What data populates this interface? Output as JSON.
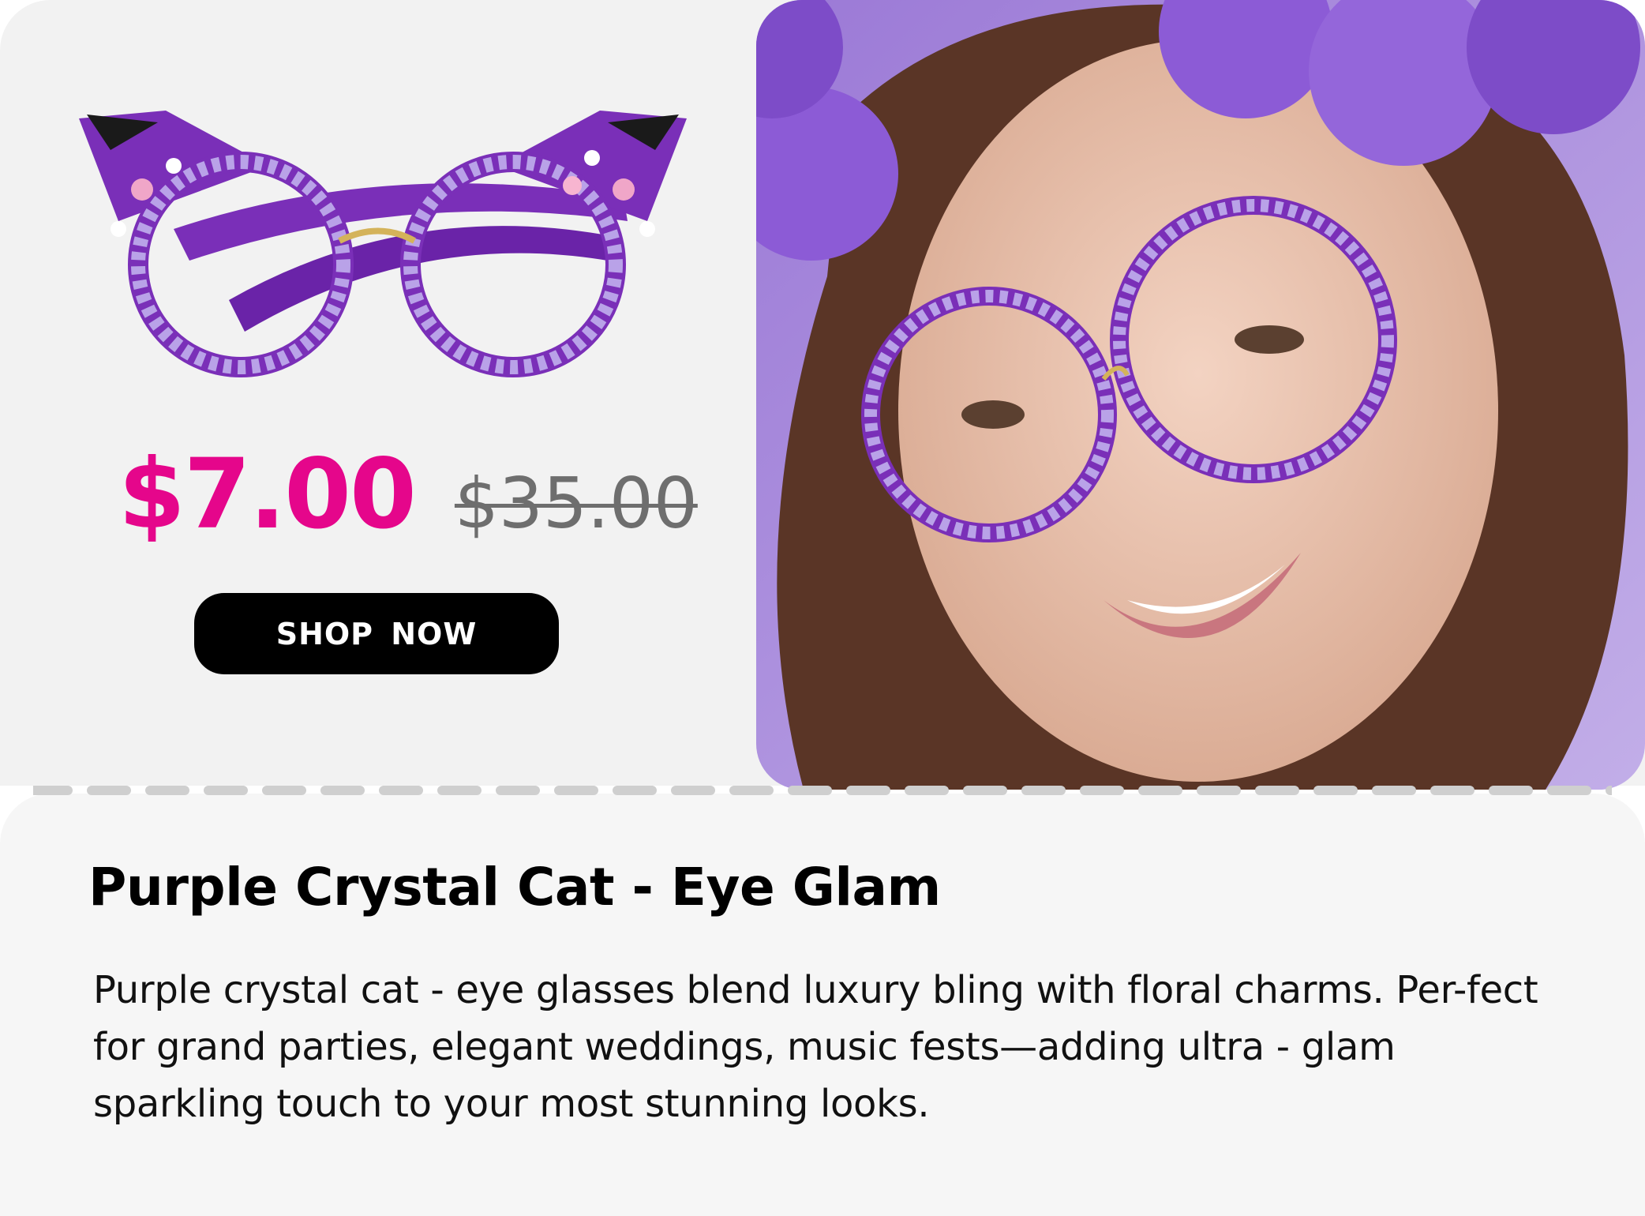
{
  "price": {
    "sale": "$7.00",
    "original": "$35.00",
    "sale_color": "#e5068b",
    "original_color": "#6e6e6e"
  },
  "cta": {
    "label": "SHOP  NOW"
  },
  "product": {
    "title": "Purple Crystal Cat - Eye Glam",
    "description": "Purple crystal cat - eye glasses blend luxury bling with floral charms. Per-fect for grand parties, elegant weddings, music fests—adding ultra - glam sparkling touch to your most stunning looks."
  },
  "images": {
    "product_icon": "purple-cat-eye-glasses-icon",
    "model_icon": "model-wearing-glasses-photo"
  },
  "colors": {
    "accent_purple": "#7a2fb8",
    "crystal_lavender": "#b9a2e8",
    "button_bg": "#000000",
    "card_bg": "#f2f2f2"
  }
}
